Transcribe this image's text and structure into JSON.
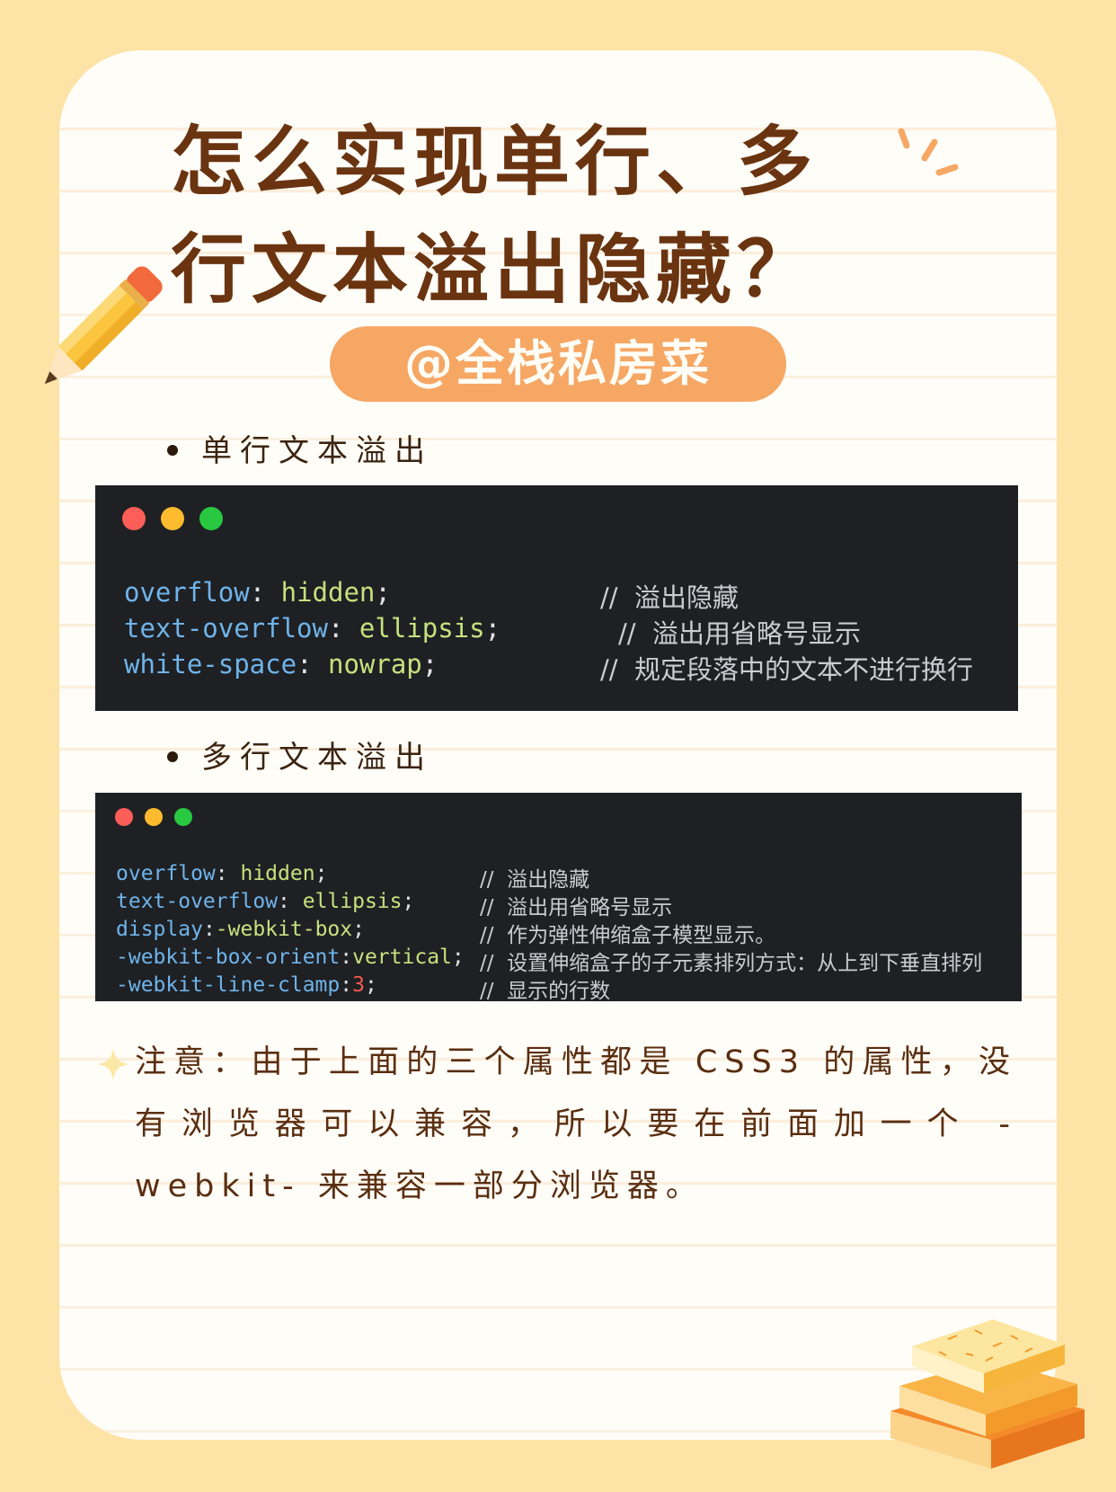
{
  "title": {
    "line1": "怎么实现单行、多",
    "line2": "行文本溢出隐藏？"
  },
  "author": "@全栈私房菜",
  "section1": {
    "heading": "单行文本溢出",
    "lines": [
      {
        "prop": "overflow",
        "sep": ": ",
        "value": "hidden",
        "end": ";",
        "comment": "//  溢出隐藏"
      },
      {
        "prop": "text-overflow",
        "sep": ": ",
        "value": "ellipsis",
        "end": ";",
        "comment": "//  溢出用省略号显示"
      },
      {
        "prop": "white-space",
        "sep": ": ",
        "value": "nowrap",
        "end": ";",
        "comment": "//  规定段落中的文本不进行换行"
      }
    ]
  },
  "section2": {
    "heading": "多行文本溢出",
    "lines": [
      {
        "prop": "overflow",
        "sep": ": ",
        "value": "hidden",
        "end": ";",
        "comment": "//  溢出隐藏"
      },
      {
        "prop": "text-overflow",
        "sep": ": ",
        "value": "ellipsis",
        "end": ";",
        "comment": "//  溢出用省略号显示"
      },
      {
        "prop": "display",
        "sep": ":",
        "value": "-webkit-box",
        "end": ";",
        "comment": "//  作为弹性伸缩盒子模型显示。"
      },
      {
        "prop": "-webkit-box-orient",
        "sep": ":",
        "value": "vertical",
        "end": ";",
        "comment": "//  设置伸缩盒子的子元素排列方式：从上到下垂直排列"
      },
      {
        "prop": "-webkit-line-clamp",
        "sep": ":",
        "value": "3",
        "end": ";",
        "comment": "//  显示的行数"
      }
    ]
  },
  "note": "注意：由于上面的三个属性都是 CSS3 的属性，没有浏览器可以兼容，所以要在前面加一个 -webkit- 来兼容一部分浏览器。",
  "colors": {
    "background": "#fde3a6",
    "title": "#6a3410",
    "author_pill": "#f6a764",
    "code_bg": "#1e2024",
    "code_property": "#6fb4ea",
    "code_value": "#c7e17d"
  },
  "icons": [
    "pencil-icon",
    "sparkle-lines-icon",
    "star-sparkle-icon",
    "books-stack-icon",
    "window-traffic-lights-icon"
  ]
}
